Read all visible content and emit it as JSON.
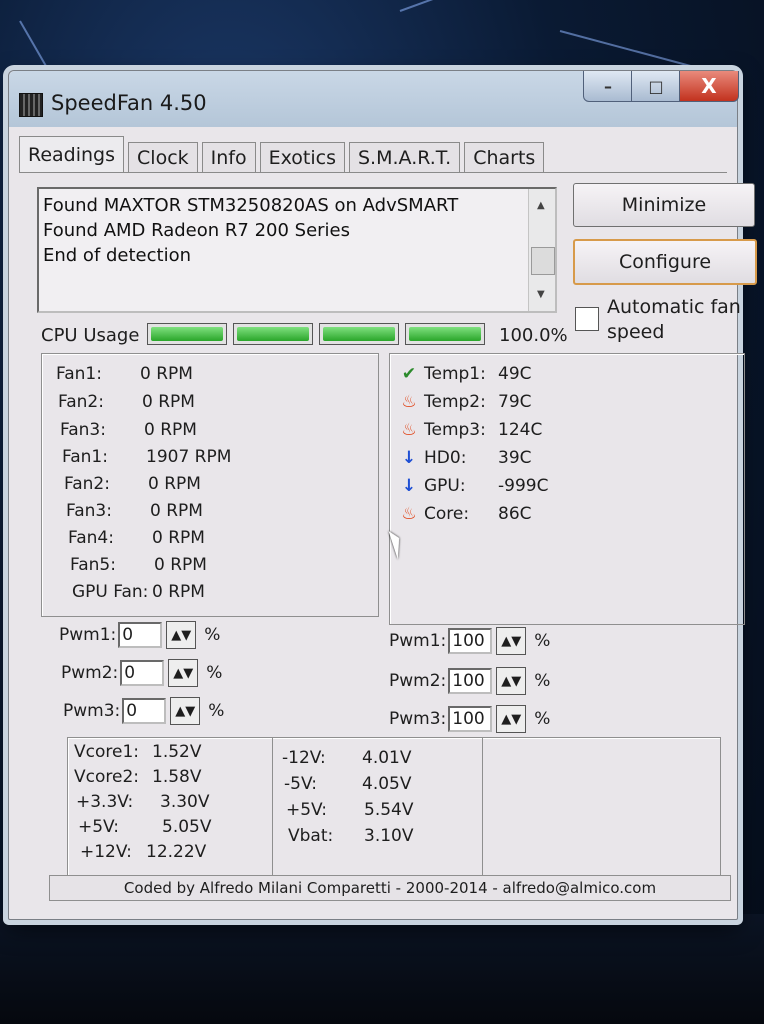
{
  "window": {
    "title": "SpeedFan 4.50",
    "controls": {
      "minimize": "–",
      "maximize": "□",
      "close": "X"
    }
  },
  "tabs": [
    {
      "label": "Readings"
    },
    {
      "label": "Clock"
    },
    {
      "label": "Info"
    },
    {
      "label": "Exotics"
    },
    {
      "label": "S.M.A.R.T."
    },
    {
      "label": "Charts"
    }
  ],
  "log": {
    "lines": [
      "Found MAXTOR STM3250820AS on AdvSMART",
      "Found AMD Radeon R7 200 Series",
      "End of detection"
    ]
  },
  "buttons": {
    "minimize": "Minimize",
    "configure": "Configure"
  },
  "auto_fan": {
    "label": "Automatic fan speed",
    "checked": false
  },
  "cpu_usage": {
    "label": "CPU Usage",
    "value": "100.0%",
    "segments": 4
  },
  "fans": [
    {
      "name": "Fan1:",
      "value": "0 RPM"
    },
    {
      "name": "Fan2:",
      "value": "0 RPM"
    },
    {
      "name": "Fan3:",
      "value": "0 RPM"
    },
    {
      "name": "Fan1:",
      "value": "1907 RPM"
    },
    {
      "name": "Fan2:",
      "value": "0 RPM"
    },
    {
      "name": "Fan3:",
      "value": "0 RPM"
    },
    {
      "name": "Fan4:",
      "value": "0 RPM"
    },
    {
      "name": "Fan5:",
      "value": "0 RPM"
    },
    {
      "name": "GPU Fan:",
      "value": "0 RPM"
    }
  ],
  "temps": [
    {
      "icon": "check-icon",
      "name": "Temp1:",
      "value": "49C"
    },
    {
      "icon": "flame-icon",
      "name": "Temp2:",
      "value": "79C"
    },
    {
      "icon": "flame-icon",
      "name": "Temp3:",
      "value": "124C"
    },
    {
      "icon": "down-arrow-icon",
      "name": "HD0:",
      "value": "39C"
    },
    {
      "icon": "down-arrow-icon",
      "name": "GPU:",
      "value": "-999C"
    },
    {
      "icon": "flame-icon",
      "name": "Core:",
      "value": "86C"
    }
  ],
  "pwm_left": [
    {
      "label": "Pwm1:",
      "value": "0",
      "unit": "%"
    },
    {
      "label": "Pwm2:",
      "value": "0",
      "unit": "%"
    },
    {
      "label": "Pwm3:",
      "value": "0",
      "unit": "%"
    }
  ],
  "pwm_right": [
    {
      "label": "Pwm1:",
      "value": "100",
      "unit": "%"
    },
    {
      "label": "Pwm2:",
      "value": "100",
      "unit": "%"
    },
    {
      "label": "Pwm3:",
      "value": "100",
      "unit": "%"
    }
  ],
  "voltages_left": [
    {
      "name": "Vcore1:",
      "value": "1.52V"
    },
    {
      "name": "Vcore2:",
      "value": "1.58V"
    },
    {
      "name": "+3.3V:",
      "value": "3.30V"
    },
    {
      "name": "+5V:",
      "value": "5.05V"
    },
    {
      "name": "+12V:",
      "value": "12.22V"
    }
  ],
  "voltages_right": [
    {
      "name": "-12V:",
      "value": "4.01V"
    },
    {
      "name": "-5V:",
      "value": "4.05V"
    },
    {
      "name": "+5V:",
      "value": "5.54V"
    },
    {
      "name": "Vbat:",
      "value": "3.10V"
    }
  ],
  "footer": {
    "text": "Coded by Alfredo Milani Comparetti - 2000-2014 - alfredo@almico.com"
  },
  "colors": {
    "ok": "#2c8a2c",
    "hot": "#e0461a",
    "cool": "#1f4fd4",
    "cpu_bar": "#2aa62a"
  }
}
